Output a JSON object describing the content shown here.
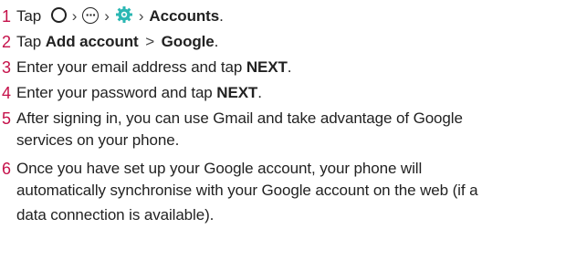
{
  "steps": [
    {
      "number": "1",
      "text_before": "Tap",
      "icons": [
        "home-button-icon",
        "apps-icon",
        "settings-gear-icon"
      ],
      "target": "Accounts",
      "end": "."
    },
    {
      "number": "2",
      "text_before": "Tap",
      "action": "Add account",
      "sep": ">",
      "target": "Google",
      "end": "."
    },
    {
      "number": "3",
      "text_before": "Enter your email address and tap",
      "target": "NEXT",
      "end": "."
    },
    {
      "number": "4",
      "text_before": "Enter your password and tap",
      "target": "NEXT",
      "end": "."
    },
    {
      "number": "5",
      "lines": [
        "After signing in, you can use Gmail and take advantage of Google",
        "services on your phone."
      ]
    },
    {
      "number": "6",
      "lines": [
        "Once you have set up your Google account, your phone will",
        "automatically synchronise with your Google account on the web (if a",
        "data connection is available)."
      ]
    }
  ],
  "colors": {
    "number": "#c5114a",
    "text": "#222222",
    "settings_icon": "#2bb7b3"
  }
}
